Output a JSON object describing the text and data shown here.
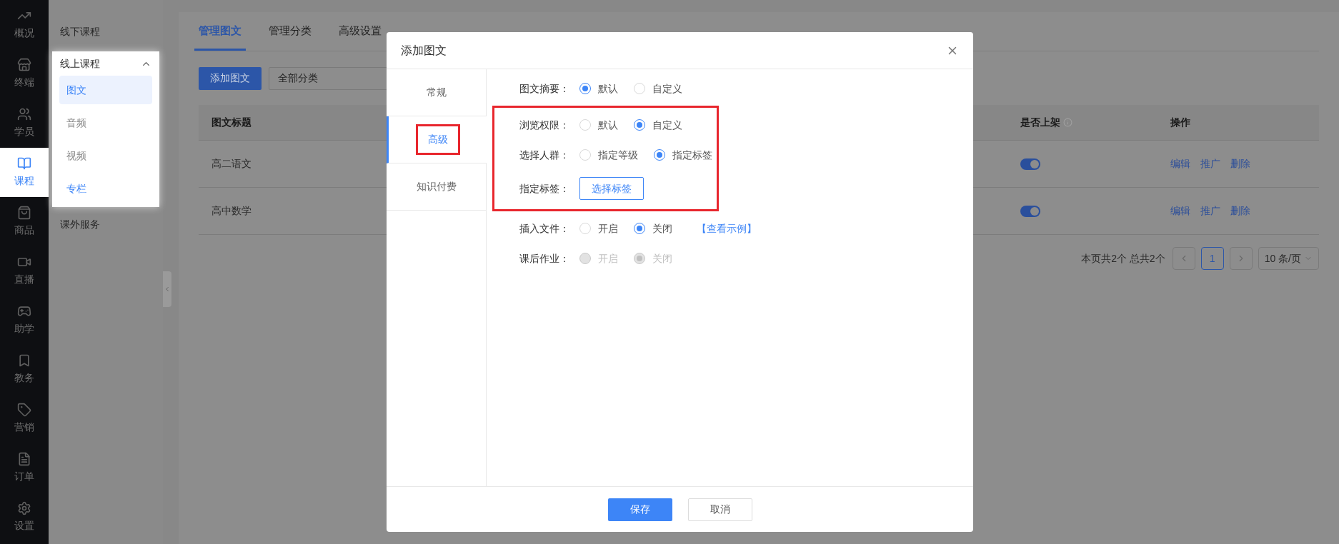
{
  "nav": [
    {
      "label": "概况",
      "selected": false
    },
    {
      "label": "终端",
      "selected": false
    },
    {
      "label": "学员",
      "selected": false
    },
    {
      "label": "课程",
      "selected": true
    },
    {
      "label": "商品",
      "selected": false
    },
    {
      "label": "直播",
      "selected": false
    },
    {
      "label": "助学",
      "selected": false
    },
    {
      "label": "教务",
      "selected": false
    },
    {
      "label": "营销",
      "selected": false
    },
    {
      "label": "订单",
      "selected": false
    },
    {
      "label": "设置",
      "selected": false
    }
  ],
  "subnav": [
    {
      "label": "线下课程"
    },
    {
      "label": "线上课程",
      "expanded": true,
      "children": [
        {
          "label": "图文",
          "selected": true,
          "emphasized": true
        },
        {
          "label": "音频",
          "selected": false,
          "emphasized": false
        },
        {
          "label": "视频",
          "selected": false,
          "emphasized": false
        },
        {
          "label": "专栏",
          "selected": false,
          "emphasized": true
        }
      ]
    },
    {
      "label": "课外服务"
    }
  ],
  "tabs": [
    {
      "label": "管理图文",
      "selected": true
    },
    {
      "label": "管理分类",
      "selected": false
    },
    {
      "label": "高级设置",
      "selected": false
    }
  ],
  "toolbar": {
    "add_button": "添加图文",
    "category_select": "全部分类"
  },
  "table": {
    "columns": [
      {
        "label": "图文标题",
        "kind": "plain"
      },
      {
        "label": "是否上架",
        "kind": "info"
      },
      {
        "label": "操作",
        "kind": "plain"
      }
    ],
    "rows": [
      {
        "title": "高二语文",
        "on_shelf": true,
        "actions": [
          "编辑",
          "推广",
          "删除"
        ]
      },
      {
        "title": "高中数学",
        "on_shelf": true,
        "actions": [
          "编辑",
          "推广",
          "删除"
        ]
      }
    ]
  },
  "pagination": {
    "summary": "本页共2个 总共2个",
    "pages": [
      {
        "label": "1",
        "selected": true
      }
    ],
    "page_size": "10 条/页"
  },
  "dialog": {
    "title": "添加图文",
    "tabs": [
      {
        "label": "常规",
        "selected": false,
        "highlighted": false
      },
      {
        "label": "高级",
        "selected": true,
        "highlighted": true
      },
      {
        "label": "知识付费",
        "selected": false,
        "highlighted": false
      }
    ],
    "sections": [
      {
        "highlighted": false,
        "fields": [
          {
            "kind": "radio",
            "label": "图文摘要：",
            "disabled": false,
            "options": [
              {
                "label": "默认",
                "selected": true
              },
              {
                "label": "自定义",
                "selected": false
              }
            ]
          }
        ]
      },
      {
        "highlighted": true,
        "fields": [
          {
            "kind": "radio",
            "label": "浏览权限：",
            "disabled": false,
            "options": [
              {
                "label": "默认",
                "selected": false
              },
              {
                "label": "自定义",
                "selected": true
              }
            ]
          },
          {
            "kind": "radio",
            "label": "选择人群：",
            "disabled": false,
            "options": [
              {
                "label": "指定等级",
                "selected": false
              },
              {
                "label": "指定标签",
                "selected": true
              }
            ]
          },
          {
            "kind": "button",
            "label": "指定标签：",
            "button": "选择标签"
          }
        ]
      },
      {
        "highlighted": false,
        "fields": [
          {
            "kind": "radio",
            "label": "插入文件：",
            "disabled": false,
            "options": [
              {
                "label": "开启",
                "selected": false
              },
              {
                "label": "关闭",
                "selected": true
              }
            ],
            "link": "【查看示例】"
          },
          {
            "kind": "radio",
            "label": "课后作业：",
            "disabled": true,
            "options": [
              {
                "label": "开启",
                "selected": false
              },
              {
                "label": "关闭",
                "selected": true
              }
            ]
          }
        ]
      }
    ],
    "buttons": [
      {
        "label": "保存",
        "kind": "primary"
      },
      {
        "label": "取消",
        "kind": "secondary"
      }
    ]
  }
}
